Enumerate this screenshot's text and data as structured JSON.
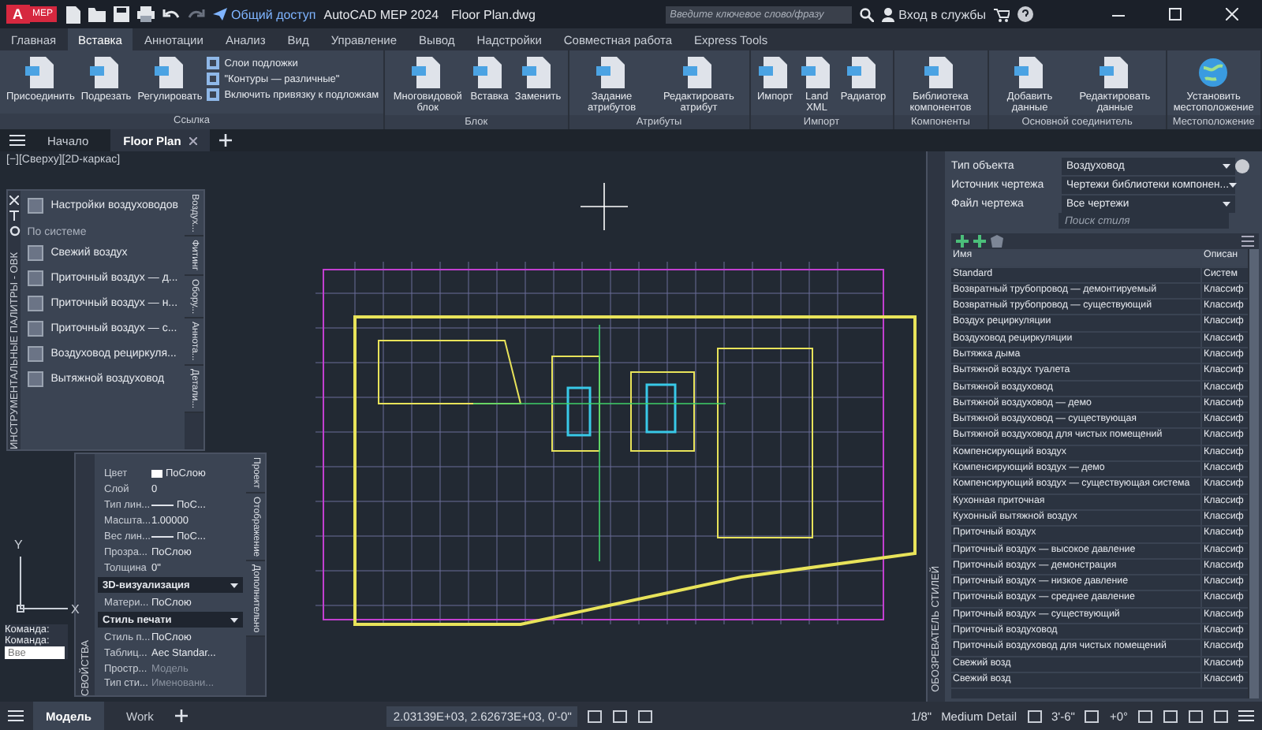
{
  "titlebar": {
    "logo": "A",
    "badge": "MEP",
    "share": "Общий доступ",
    "app": "AutoCAD MEP 2024",
    "file": "Floor Plan.dwg",
    "search": {
      "placeholder": "Введите ключевое слово/фразу"
    },
    "signin": "Вход в службы"
  },
  "ribbon_tabs": [
    {
      "label": "Главная",
      "selected": false
    },
    {
      "label": "Вставка",
      "selected": true
    },
    {
      "label": "Аннотации",
      "selected": false
    },
    {
      "label": "Анализ",
      "selected": false
    },
    {
      "label": "Вид",
      "selected": false
    },
    {
      "label": "Управление",
      "selected": false
    },
    {
      "label": "Вывод",
      "selected": false
    },
    {
      "label": "Надстройки",
      "selected": false
    },
    {
      "label": "Совместная работа",
      "selected": false
    },
    {
      "label": "Express Tools",
      "selected": false
    }
  ],
  "ribbon_groups": [
    {
      "title": "Ссылка",
      "items": [
        {
          "kind": "large",
          "label": "Присоединить"
        },
        {
          "kind": "large",
          "label": "Подрезать"
        },
        {
          "kind": "large",
          "label": "Регулировать"
        },
        {
          "kind": "small",
          "label": "Слои подложки"
        },
        {
          "kind": "small",
          "label": "\"Контуры — различные\""
        },
        {
          "kind": "small",
          "label": "Включить привязку к подложкам"
        }
      ]
    },
    {
      "title": "Блок",
      "items": [
        {
          "kind": "large",
          "label": "Многовидовой блок"
        },
        {
          "kind": "large",
          "label": "Вставка"
        },
        {
          "kind": "large",
          "label": "Заменить"
        }
      ]
    },
    {
      "title": "Атрибуты",
      "items": [
        {
          "kind": "large",
          "label": "Задание атрибутов"
        },
        {
          "kind": "large",
          "label": "Редактировать атрибут"
        }
      ]
    },
    {
      "title": "Импорт",
      "items": [
        {
          "kind": "large",
          "label": "Импорт"
        },
        {
          "kind": "large",
          "label": "Land XML"
        },
        {
          "kind": "large",
          "label": "Радиатор"
        }
      ]
    },
    {
      "title": "Компоненты",
      "items": [
        {
          "kind": "large",
          "label": "Библиотека компонентов"
        }
      ]
    },
    {
      "title": "Основной соединитель",
      "items": [
        {
          "kind": "large",
          "label": "Добавить данные"
        },
        {
          "kind": "large",
          "label": "Редактировать данные"
        }
      ]
    },
    {
      "title": "Местоположение",
      "items": [
        {
          "kind": "globe",
          "label": "Установить местоположение"
        }
      ]
    }
  ],
  "doc_tabs": [
    {
      "label": "Начало",
      "selected": false
    },
    {
      "label": "Floor Plan",
      "selected": true
    }
  ],
  "viewport": {
    "label": "[−][Сверху][2D-каркас]",
    "axis_y": "Y",
    "axis_x": "X"
  },
  "tool_palette": {
    "title": "ИНСТРУМЕНТАЛЬНЫЕ ПАЛИТРЫ - ОВК",
    "top_item": "Настройки воздуховодов",
    "section": "По системе",
    "items": [
      "Свежий воздух",
      "Приточный воздух — д...",
      "Приточный воздух — н...",
      "Приточный воздух — с...",
      "Воздуховод рециркуля...",
      "Вытяжной воздуховод"
    ],
    "tabs": [
      "Воздух...",
      "Фитинг",
      "Обору...",
      "Аннота...",
      "Детали..."
    ]
  },
  "properties": {
    "title": "СВОЙСТВА",
    "rows": [
      {
        "kind": "swatch",
        "label": "Цвет",
        "value": "ПоСлою"
      },
      {
        "kind": "prop",
        "label": "Слой",
        "value": "0"
      },
      {
        "kind": "line",
        "label": "Тип лин...",
        "value": "ПоС..."
      },
      {
        "kind": "prop",
        "label": "Масшта...",
        "value": "1.00000"
      },
      {
        "kind": "line",
        "label": "Вес лин...",
        "value": "ПоС..."
      },
      {
        "kind": "prop",
        "label": "Прозра...",
        "value": "ПоСлою"
      },
      {
        "kind": "prop",
        "label": "Толщина",
        "value": "0\""
      },
      {
        "kind": "section",
        "label": "3D-визуализация"
      },
      {
        "kind": "prop",
        "label": "Матери...",
        "value": "ПоСлою"
      },
      {
        "kind": "section",
        "label": "Стиль печати"
      },
      {
        "kind": "prop",
        "label": "Стиль п...",
        "value": "ПоСлою"
      },
      {
        "kind": "prop",
        "label": "Таблиц...",
        "value": "Aec Standar..."
      },
      {
        "kind": "grey",
        "label": "Простр...",
        "value": "Модель"
      },
      {
        "kind": "grey",
        "label": "Тип сти...",
        "value": "Именовани..."
      }
    ],
    "tabs": [
      "Проект",
      "Отображение",
      "Дополнительно"
    ]
  },
  "command": {
    "lines": [
      "Команда:",
      "Команда:"
    ],
    "placeholder": "Вве"
  },
  "style_browser": {
    "title": "ОБОЗРЕВАТЕЛЬ СТИЛЕЙ",
    "filters": [
      {
        "label": "Тип объекта",
        "value": "Воздуховод"
      },
      {
        "label": "Источник чертежа",
        "value": "Чертежи библиотеки компонен..."
      },
      {
        "label": "Файл чертежа",
        "value": "Все чертежи"
      }
    ],
    "search": {
      "placeholder": "Поиск стиля"
    },
    "columns": [
      "Имя",
      "Описан"
    ],
    "rows": [
      [
        "Standard",
        "Систем"
      ],
      [
        "Возвратный трубопровод — демонтируемый",
        "Классиф"
      ],
      [
        "Возвратный трубопровод — существующий",
        "Классиф"
      ],
      [
        "Воздух рециркуляции",
        "Классиф"
      ],
      [
        "Воздуховод рециркуляции",
        "Классиф"
      ],
      [
        "Вытяжка дыма",
        "Классиф"
      ],
      [
        "Вытяжной воздух туалета",
        "Классиф"
      ],
      [
        "Вытяжной воздуховод",
        "Классиф"
      ],
      [
        "Вытяжной воздуховод — демо",
        "Классиф"
      ],
      [
        "Вытяжной воздуховод — существующая",
        "Классиф"
      ],
      [
        "Вытяжной воздуховод для чистых помещений",
        "Классиф"
      ],
      [
        "Компенсирующий воздух",
        "Классиф"
      ],
      [
        "Компенсирующий воздух — демо",
        "Классиф"
      ],
      [
        "Компенсирующий воздух — существующая система",
        "Классиф"
      ],
      [
        "Кухонная приточная",
        "Классиф"
      ],
      [
        "Кухонный вытяжной воздух",
        "Классиф"
      ],
      [
        "Приточный воздух",
        "Классиф"
      ],
      [
        "Приточный воздух — высокое давление",
        "Классиф"
      ],
      [
        "Приточный воздух — демонстрация",
        "Классиф"
      ],
      [
        "Приточный воздух — низкое давление",
        "Классиф"
      ],
      [
        "Приточный воздух — среднее давление",
        "Классиф"
      ],
      [
        "Приточный воздух — существующий",
        "Классиф"
      ],
      [
        "Приточный воздуховод",
        "Классиф"
      ],
      [
        "Приточный воздуховод для чистых помещений",
        "Классиф"
      ],
      [
        "Свежий возд",
        "Классиф"
      ],
      [
        "Свежий возд",
        "Классиф"
      ]
    ]
  },
  "status": {
    "layout_tabs": [
      {
        "label": "Модель",
        "selected": true
      },
      {
        "label": "Work",
        "selected": false
      }
    ],
    "coords": "2.03139E+03, 2.62673E+03, 0'-0\"",
    "scale": "1/8\"",
    "detail": "Medium Detail",
    "elevation": "3'-6\"",
    "angle": "+0°"
  }
}
